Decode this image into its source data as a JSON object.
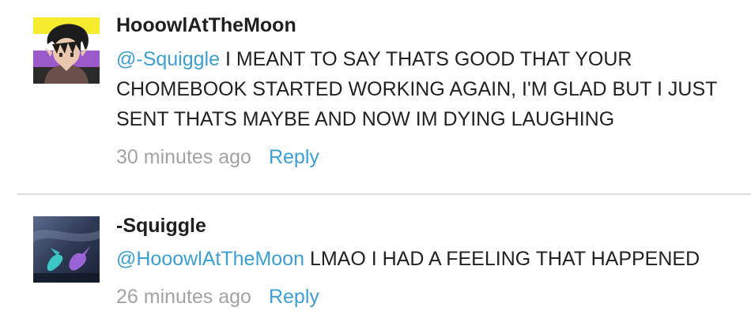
{
  "comments": [
    {
      "author": "HooowlAtTheMoon",
      "mention": "@-Squiggle",
      "text": " I MEANT TO SAY THATS GOOD THAT YOUR CHOMEBOOK STARTED WORKING AGAIN, I'M GLAD BUT I JUST SENT THATS MAYBE AND NOW IM DYING LAUGHING",
      "timestamp": "30 minutes ago",
      "reply_label": "Reply",
      "avatar_icon": "profile-picture-anime-boy"
    },
    {
      "author": "-Squiggle",
      "mention": "@HooowlAtTheMoon",
      "text": " LMAO I HAD A FEELING THAT HAPPENED",
      "timestamp": "26 minutes ago",
      "reply_label": "Reply",
      "avatar_icon": "profile-picture-dark-art"
    }
  ],
  "colors": {
    "link": "#3b9fd3",
    "timestamp": "#a3a3a3",
    "text": "#222222",
    "divider": "#dcdcdc"
  }
}
